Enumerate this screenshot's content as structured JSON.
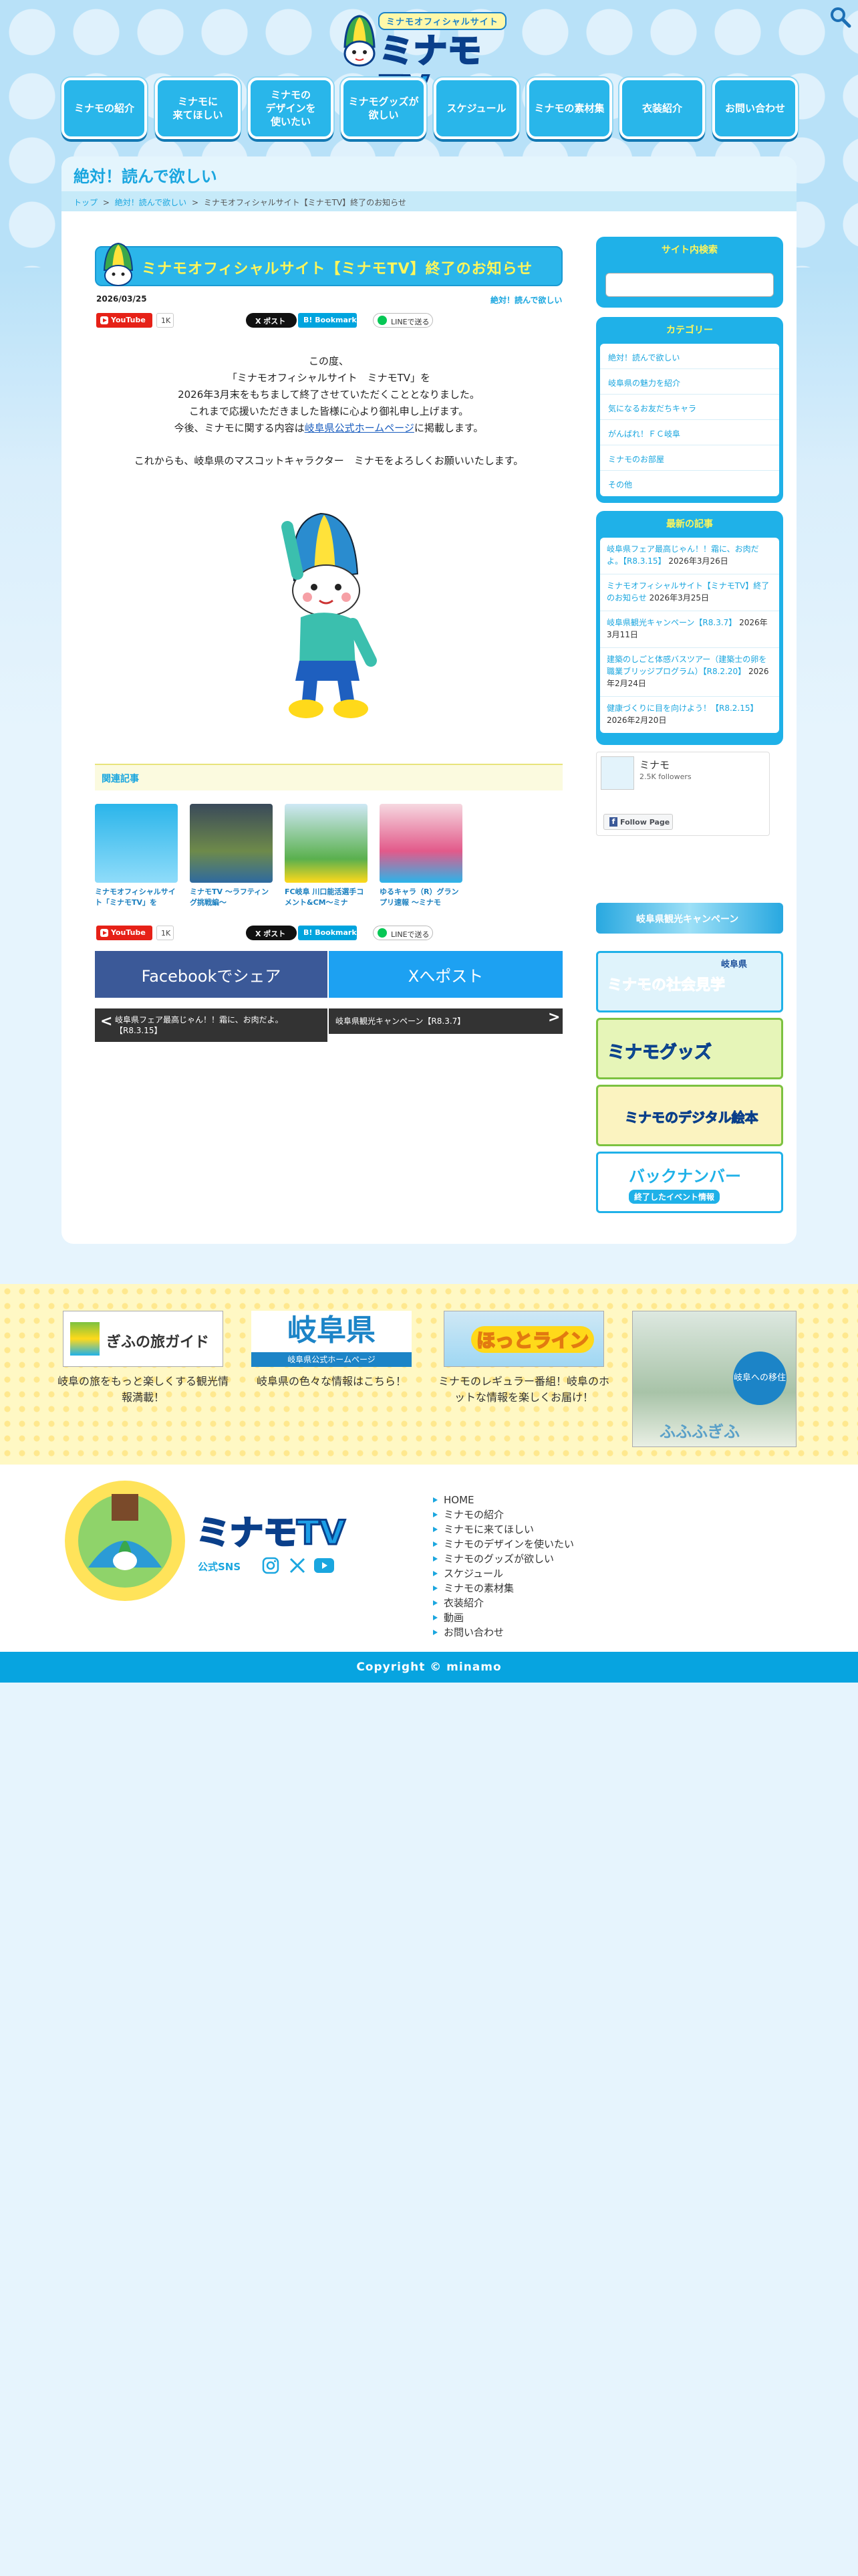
{
  "header": {
    "logo_tag": "ミナモオフィシャルサイト",
    "logo_text": "ミナモTV",
    "nav": [
      {
        "label": "ミナモの紹介"
      },
      {
        "label": "ミナモに\n来てほしい"
      },
      {
        "label": "ミナモの\nデザインを\n使いたい"
      },
      {
        "label": "ミナモグッズが\n欲しい"
      },
      {
        "label": "スケジュール"
      },
      {
        "label": "ミナモの素材集"
      },
      {
        "label": "衣装紹介"
      },
      {
        "label": "お問い合わせ"
      }
    ]
  },
  "page": {
    "title": "絶対！読んで欲しい",
    "breadcrumb": [
      "トップ",
      "絶対！読んで欲しい",
      "ミナモオフィシャルサイト【ミナモTV】終了のお知らせ"
    ],
    "breadcrumb_sep": ">"
  },
  "article": {
    "title": "ミナモオフィシャルサイト【ミナモTV】終了のお知らせ",
    "date": "2026/03/25",
    "category": "絶対！読んで欲しい",
    "share": {
      "youtube": "YouTube",
      "youtube_count": "1K",
      "xpost": "X ポスト",
      "bookmark": "B! Bookmark",
      "line": "LINEで送る"
    },
    "body": [
      "この度、",
      "「ミナモオフィシャルサイト　ミナモTV」を",
      "2026年3月末をもちまして終了させていただくこととなりました。",
      "これまで応援いただきました皆様に心より御礼申し上げます。"
    ],
    "body_link_pre": "今後、ミナモに関する内容は",
    "body_link": "岐阜県公式ホームページ",
    "body_link_post": "に掲載します。",
    "body_last": "これからも、岐阜県のマスコットキャラクター　ミナモをよろしくお願いいたします。",
    "related_heading": "関連記事",
    "related": [
      {
        "title": "ミナモオフィシャルサイト「ミナモTV」を"
      },
      {
        "title": "ミナモTV ～ラフティング挑戦編～"
      },
      {
        "title": "FC岐阜 川口能活選手コメント&CM～ミナ"
      },
      {
        "title": "ゆるキャラ（R）グランプリ速報 ～ミナモ"
      }
    ],
    "facebook_share": "Facebookでシェア",
    "x_share": "Xへポスト",
    "prev_post": "岐阜県フェア最高じゃん！！霜に、お肉だよ。【R8.3.15】",
    "next_post": "岐阜県観光キャンペーン【R8.3.7】",
    "prev_arrow": "<",
    "next_arrow": ">"
  },
  "sidebar": {
    "search_heading": "サイト内検索",
    "category_heading": "カテゴリー",
    "categories": [
      "絶対！読んで欲しい",
      "岐阜県の魅力を紹介",
      "気になるお友だちキャラ",
      "がんばれ！ＦＣ岐阜",
      "ミナモのお部屋",
      "その他"
    ],
    "news_heading": "最新の記事",
    "news": [
      {
        "title": "岐阜県フェア最高じゃん！！霜に、お肉だよ。【R8.3.15】",
        "date": "2026年3月26日"
      },
      {
        "title": "ミナモオフィシャルサイト【ミナモTV】終了のお知らせ",
        "date": "2026年3月25日"
      },
      {
        "title": "岐阜県観光キャンペーン【R8.3.7】",
        "date": "2026年3月11日"
      },
      {
        "title": "建築のしごと体感バスツアー（建築士の卵を職業ブリッジプログラム）【R8.2.20】",
        "date": "2026年2月24日"
      },
      {
        "title": "健康づくりに目を向けよう！【R8.2.15】",
        "date": "2026年2月20日"
      }
    ],
    "fb": {
      "name": "ミナモ",
      "followers": "2.5K followers",
      "follow": "Follow Page"
    },
    "banners": [
      {
        "text": "ミナモの社会見学",
        "pre": "岐阜県"
      },
      {
        "text": "ミナモグッズ"
      },
      {
        "text": "ミナモのデジタル絵本"
      },
      {
        "text": "バックナンバー",
        "sub": "終了したイベント情報"
      }
    ],
    "top_banner": "岐阜県観光キャンペーン"
  },
  "partners": [
    {
      "logo": "ぎふの旅ガイド",
      "caption": "岐阜の旅をもっと楽しくする観光情報満載！"
    },
    {
      "logo": "岐阜県",
      "logo_sub": "岐阜県公式ホームページ",
      "caption": "岐阜県の色々な情報はこちら！"
    },
    {
      "logo": "ほっとライン",
      "caption": "ミナモのレギュラー番組！岐阜のホットな情報を楽しくお届け！"
    },
    {
      "logo": "ふふふぎふ",
      "sub": "岐阜への移住"
    }
  ],
  "footer": {
    "logo_text": "ミナモTV",
    "sns_label": "公式SNS",
    "links": [
      "HOME",
      "ミナモの紹介",
      "ミナモに来てほしい",
      "ミナモのデザインを使いたい",
      "ミナモのグッズが欲しい",
      "スケジュール",
      "ミナモの素材集",
      "衣装紹介",
      "動画",
      "お問い合わせ"
    ],
    "copyright": "Copyright © minamo"
  },
  "colors": {
    "accent": "#1aa6df",
    "title_yellow": "#fff65a",
    "facebook": "#3b5998",
    "x": "#1da1f2"
  }
}
